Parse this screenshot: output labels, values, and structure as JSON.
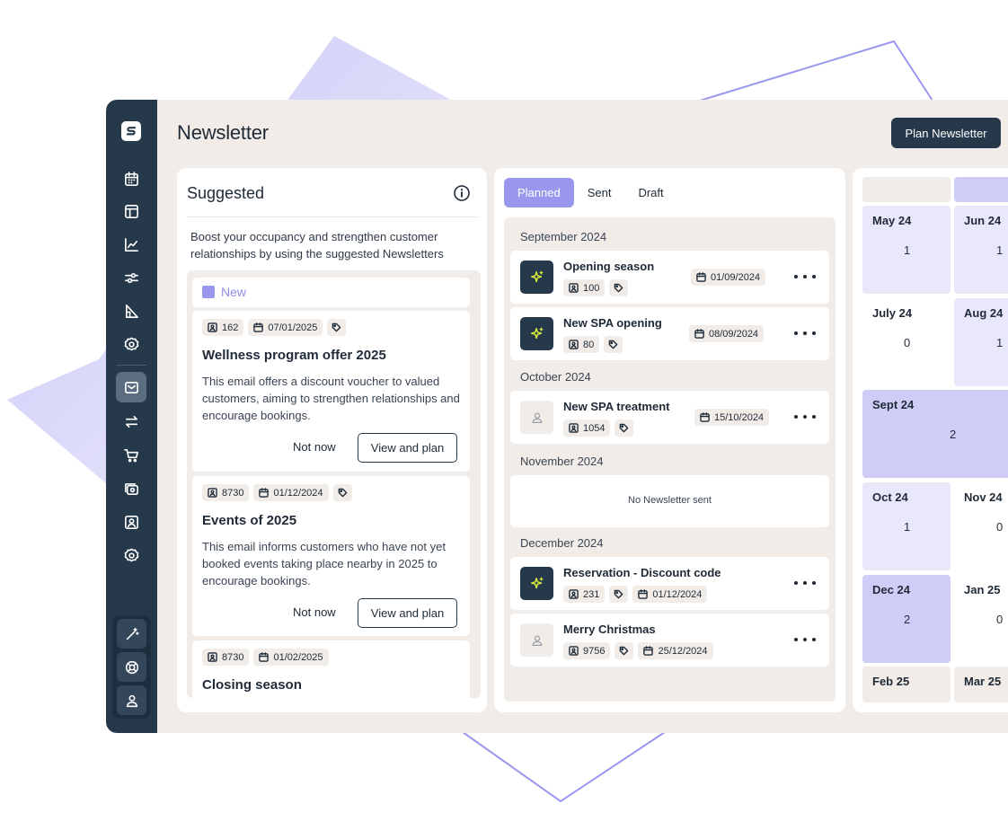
{
  "page": {
    "title": "Newsletter",
    "plan_button": "Plan Newsletter"
  },
  "sidebar": {
    "logo": "s-logo-icon",
    "items": [
      {
        "icon": "calendar-icon",
        "active": false
      },
      {
        "icon": "layout-icon",
        "active": false
      },
      {
        "icon": "chart-line-icon",
        "active": false
      },
      {
        "icon": "sliders-icon",
        "active": false
      },
      {
        "icon": "ruler-icon",
        "active": false
      },
      {
        "icon": "gear-icon",
        "active": false
      },
      {
        "icon": "mail-icon",
        "active": true
      },
      {
        "icon": "swap-icon",
        "active": false
      },
      {
        "icon": "cart-icon",
        "active": false
      },
      {
        "icon": "cash-icon",
        "active": false
      },
      {
        "icon": "contact-icon",
        "active": false
      },
      {
        "icon": "gear-icon",
        "active": false
      }
    ],
    "bottom": [
      "magic-wand-icon",
      "lifebuoy-icon",
      "user-icon"
    ]
  },
  "suggested": {
    "title": "Suggested",
    "description": "Boost your occupancy and strengthen customer relationships by using the suggested Newsletters",
    "new_label": "New",
    "cards": [
      {
        "recipients": "162",
        "date": "07/01/2025",
        "title": "Wellness program offer 2025",
        "description": "This email offers a discount voucher to valued customers, aiming to strengthen relationships and encourage bookings.",
        "secondary": "Not now",
        "primary": "View and plan"
      },
      {
        "recipients": "8730",
        "date": "01/12/2024",
        "title": "Events of 2025",
        "description": "This email informs customers who have not yet booked events taking place nearby in 2025 to encourage bookings.",
        "secondary": "Not now",
        "primary": "View and plan"
      },
      {
        "recipients": "8730",
        "date": "01/02/2025",
        "title": "Closing season"
      }
    ]
  },
  "planned": {
    "tabs": [
      "Planned",
      "Sent",
      "Draft"
    ],
    "active_tab": "Planned",
    "months": {
      "sep": "September 2024",
      "oct": "October 2024",
      "nov": "November 2024",
      "dec": "December 2024"
    },
    "items": [
      {
        "title": "Opening season",
        "recipients": "100",
        "date": "01/09/2024",
        "kind": "ai"
      },
      {
        "title": "New SPA opening",
        "recipients": "80",
        "date": "08/09/2024",
        "kind": "ai"
      },
      {
        "title": "New SPA treatment",
        "recipients": "1054",
        "date": "15/10/2024",
        "kind": "user"
      },
      {
        "title": "Reservation - Discount code",
        "recipients": "231",
        "date": "01/12/2024",
        "kind": "ai"
      },
      {
        "title": "Merry Christmas",
        "recipients": "9756",
        "date": "25/12/2024",
        "kind": "user"
      }
    ],
    "empty_text": "No Newsletter sent"
  },
  "calendar": {
    "cells": [
      {
        "month": "May 24",
        "count": "1"
      },
      {
        "month": "Jun 24",
        "count": "1"
      },
      {
        "month": "July 24",
        "count": "0"
      },
      {
        "month": "Aug 24",
        "count": "1"
      },
      {
        "month": "Sept 24",
        "count": "2"
      },
      {
        "month": "Oct 24",
        "count": "1"
      },
      {
        "month": "Nov 24",
        "count": "0"
      },
      {
        "month": "Dec 24",
        "count": "2"
      },
      {
        "month": "Jan 25",
        "count": "0"
      },
      {
        "month": "Feb 25"
      },
      {
        "month": "Mar 25"
      }
    ]
  },
  "colors": {
    "accent": "#9a98ee",
    "navy": "#26394b",
    "beige": "#f1ece7",
    "lavender_light": "#e9e8fb",
    "lavender_mid": "#cfcdf7",
    "spark": "#d9ec3c"
  }
}
